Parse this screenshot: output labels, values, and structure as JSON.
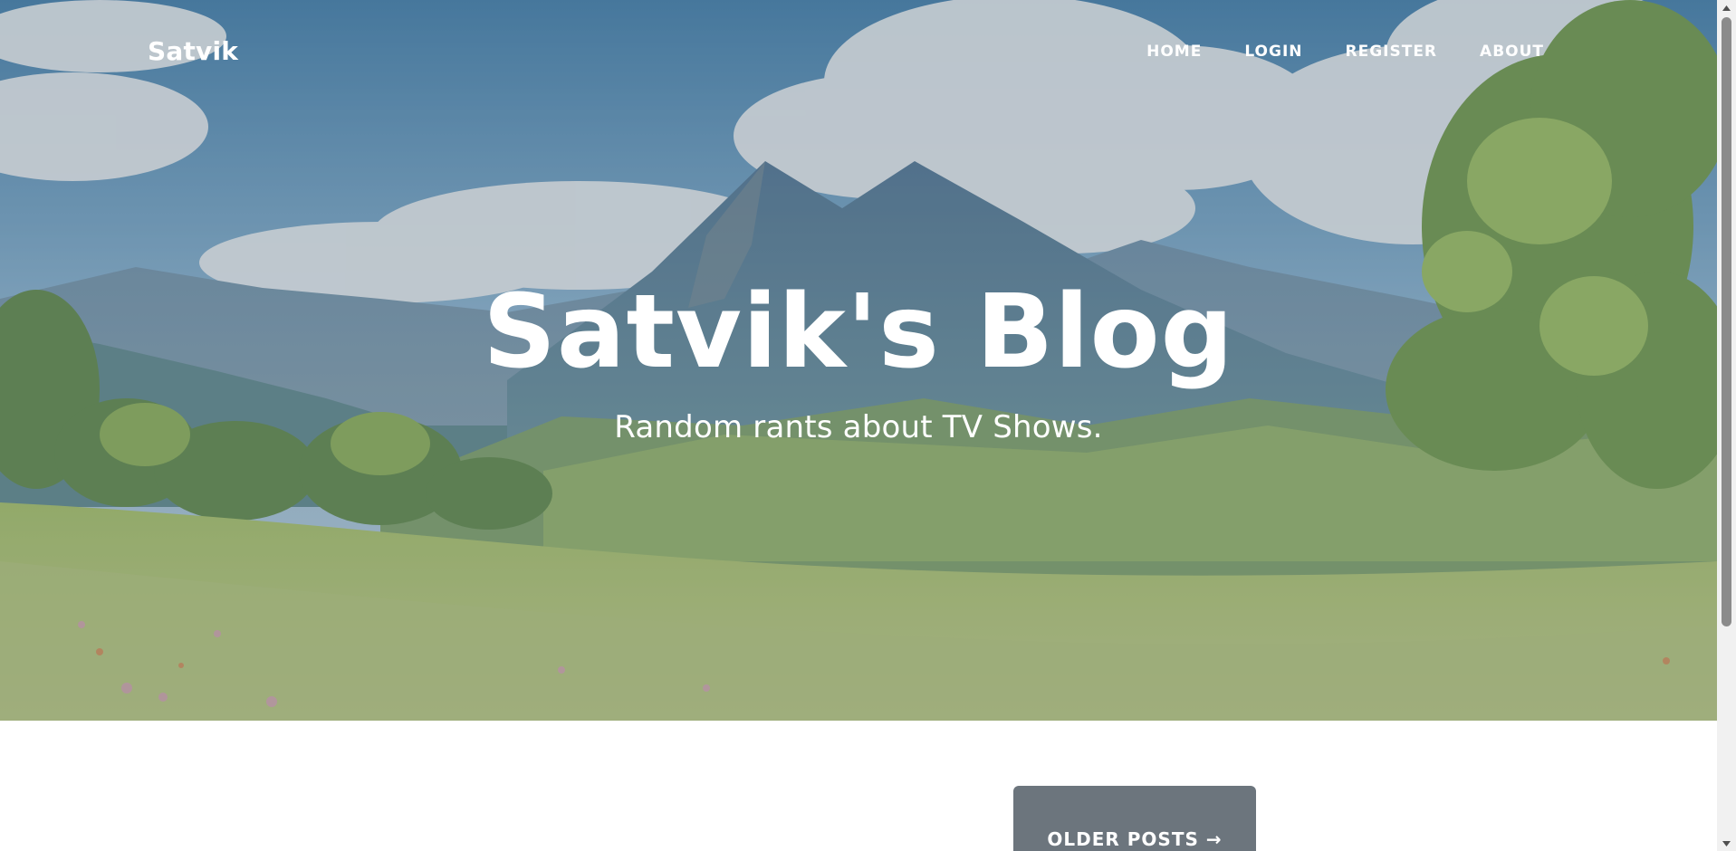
{
  "navbar": {
    "brand": "Satvik",
    "links": [
      {
        "label": "Home"
      },
      {
        "label": "Login"
      },
      {
        "label": "Register"
      },
      {
        "label": "About"
      }
    ]
  },
  "hero": {
    "title": "Satvik's Blog",
    "subtitle": "Random rants about TV Shows.",
    "background_icon": "mountain-landscape-image"
  },
  "content": {
    "older_posts_label": "Older Posts →"
  },
  "colors": {
    "button_bg": "#6c757d",
    "text_on_hero": "#ffffff",
    "page_bg": "#ffffff"
  },
  "scrollbar": {
    "up_icon": "scroll-up-arrow-icon",
    "down_icon": "scroll-down-arrow-icon"
  }
}
